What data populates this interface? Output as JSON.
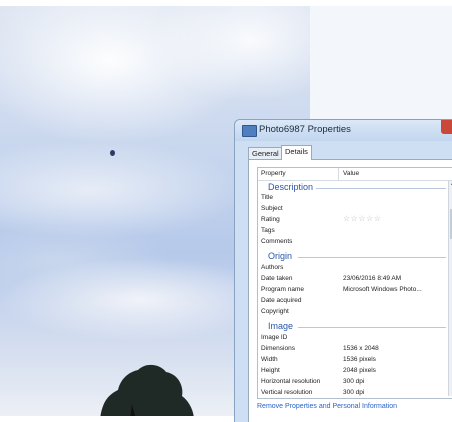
{
  "window": {
    "title": "Photo6987 Properties"
  },
  "tabs": [
    {
      "label": "General"
    },
    {
      "label": "Details"
    }
  ],
  "columns": {
    "property": "Property",
    "value": "Value"
  },
  "sections": {
    "description": {
      "heading": "Description",
      "rows": [
        {
          "property": "Title",
          "value": ""
        },
        {
          "property": "Subject",
          "value": ""
        },
        {
          "property": "Rating",
          "value": "☆☆☆☆☆"
        },
        {
          "property": "Tags",
          "value": ""
        },
        {
          "property": "Comments",
          "value": ""
        }
      ]
    },
    "origin": {
      "heading": "Origin",
      "rows": [
        {
          "property": "Authors",
          "value": ""
        },
        {
          "property": "Date taken",
          "value": "23/06/2016 8:49 AM"
        },
        {
          "property": "Program name",
          "value": "Microsoft Windows Photo..."
        },
        {
          "property": "Date acquired",
          "value": ""
        },
        {
          "property": "Copyright",
          "value": ""
        }
      ]
    },
    "image": {
      "heading": "Image",
      "rows": [
        {
          "property": "Image ID",
          "value": ""
        },
        {
          "property": "Dimensions",
          "value": "1536 x 2048"
        },
        {
          "property": "Width",
          "value": "1536 pixels"
        },
        {
          "property": "Height",
          "value": "2048 pixels"
        },
        {
          "property": "Horizontal resolution",
          "value": "300 dpi"
        },
        {
          "property": "Vertical resolution",
          "value": "300 dpi"
        }
      ]
    }
  },
  "footer": {
    "remove_link": "Remove Properties and Personal Information"
  }
}
